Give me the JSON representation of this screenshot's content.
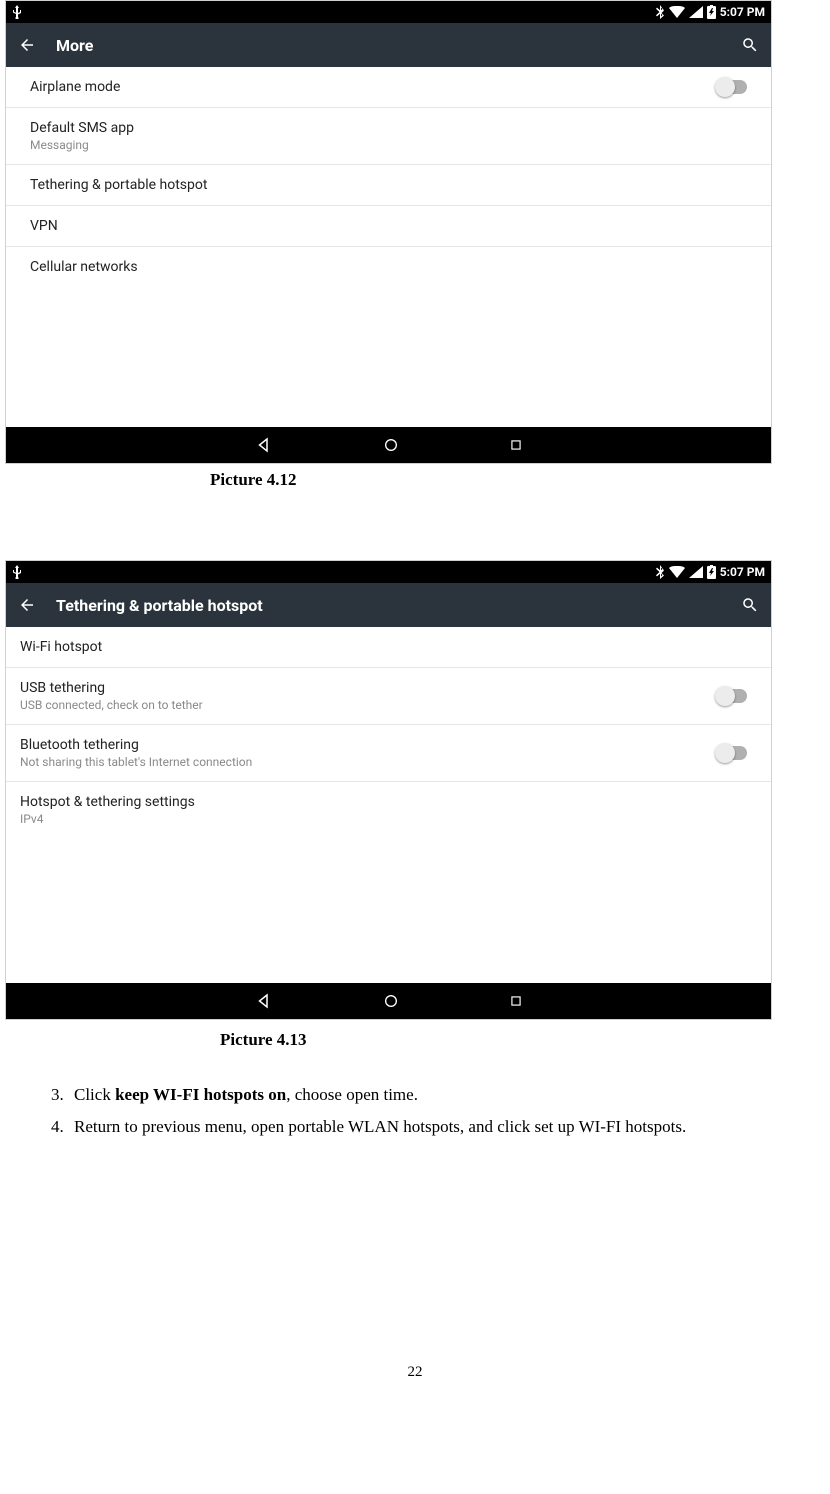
{
  "status": {
    "time": "5:07 PM"
  },
  "screenshot1": {
    "appbar_title": "More",
    "rows": {
      "airplane": {
        "title": "Airplane mode"
      },
      "sms": {
        "title": "Default SMS app",
        "subtitle": "Messaging"
      },
      "tether": {
        "title": "Tethering & portable hotspot"
      },
      "vpn": {
        "title": "VPN"
      },
      "cellular": {
        "title": "Cellular networks"
      }
    }
  },
  "caption1": "Picture 4.12",
  "screenshot2": {
    "appbar_title": "Tethering & portable hotspot",
    "rows": {
      "wifi": {
        "title": "Wi-Fi hotspot"
      },
      "usb": {
        "title": "USB tethering",
        "subtitle": "USB connected, check on to tether"
      },
      "bt": {
        "title": "Bluetooth tethering",
        "subtitle": "Not sharing this tablet's Internet connection"
      },
      "settings": {
        "title": "Hotspot & tethering settings",
        "subtitle": "IPv4"
      }
    }
  },
  "caption2": "Picture 4.13",
  "instructions": {
    "item3_prefix": "Click ",
    "item3_bold": "keep WI-FI hotspots on",
    "item3_suffix": ", choose open time.",
    "item4": "Return to previous menu, open portable WLAN hotspots, and click set up WI-FI hotspots."
  },
  "page_number": "22"
}
